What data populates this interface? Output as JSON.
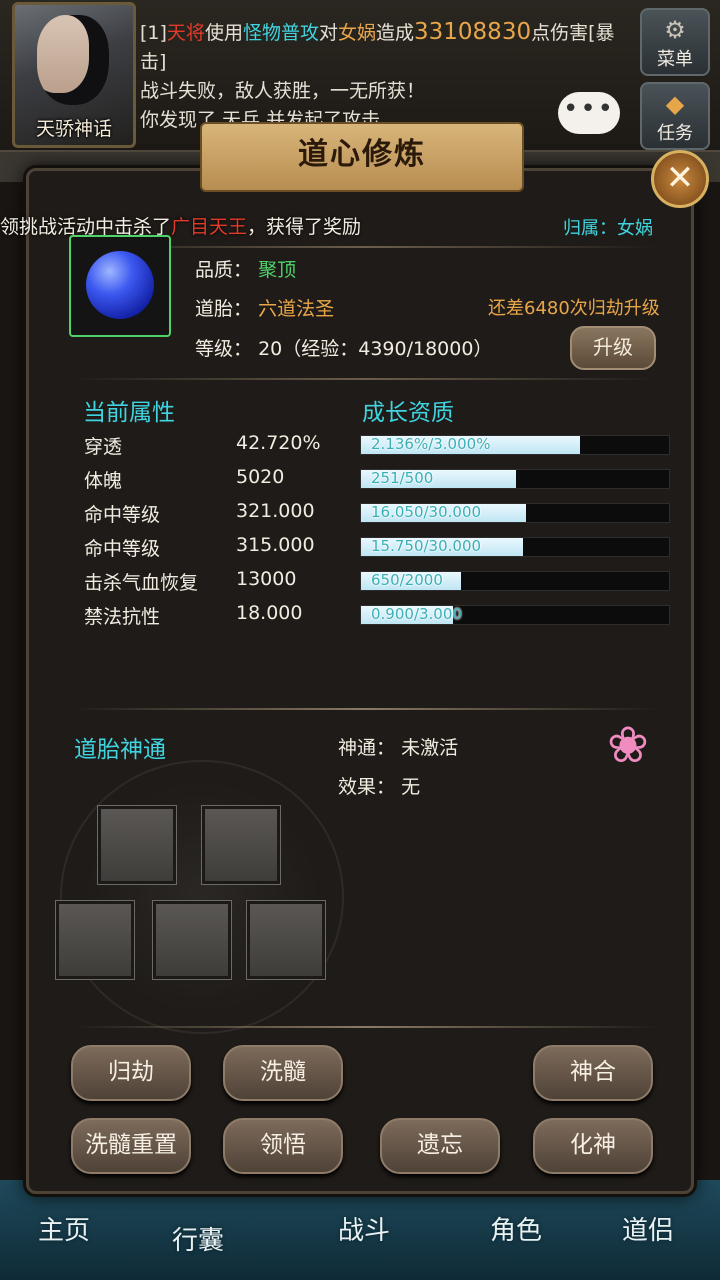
{
  "hud": {
    "player_name": "天骄神话",
    "menu_label": "菜单",
    "quest_label": "任务",
    "chat_bubble": "•••"
  },
  "chat": {
    "line1_prefix": "[1]",
    "line1_attacker": "天将",
    "line1_verb": "使用",
    "line1_skill": "怪物普攻",
    "line1_mid": "对",
    "line1_target": "女娲",
    "line1_mid2": "造成",
    "line1_damage": "33108830",
    "line1_suffix": "点伤害[暴击]",
    "line2": "战斗失败，敌人获胜，一无所获！",
    "line3": "你发现了 天兵 并发起了攻击"
  },
  "system_message": {
    "prefix": "领挑战活动中击杀了",
    "boss": "广目天王",
    "suffix": "，获得了奖励"
  },
  "modal": {
    "title": "道心修炼",
    "close": "✕",
    "belong_label": "归属：",
    "belong_value": "女娲",
    "quality_label": "品质：",
    "quality_value": "聚顶",
    "embryo_label": "道胎：",
    "embryo_value": "六道法圣",
    "need_text": "还差6480次归劫升级",
    "level_label": "等级：",
    "level_value": "20（经验：4390/18000）",
    "upgrade_btn": "升级",
    "section_current": "当前属性",
    "section_growth": "成长资质",
    "section_divine": "道胎神通",
    "divine_label": "神通：",
    "divine_value": "未激活",
    "effect_label": "效果：",
    "effect_value": "无"
  },
  "attributes": [
    {
      "name": "穿透",
      "value": "42.720%",
      "growth": "2.136%/3.000%",
      "fill": 0.712
    },
    {
      "name": "体魄",
      "value": "5020",
      "growth": "251/500",
      "fill": 0.502
    },
    {
      "name": "命中等级",
      "value": "321.000",
      "growth": "16.050/30.000",
      "fill": 0.535
    },
    {
      "name": "命中等级",
      "value": "315.000",
      "growth": "15.750/30.000",
      "fill": 0.525
    },
    {
      "name": "击杀气血恢复",
      "value": "13000",
      "growth": "650/2000",
      "fill": 0.325
    },
    {
      "name": "禁法抗性",
      "value": "18.000",
      "growth": "0.900/3.000",
      "fill": 0.3
    }
  ],
  "actions": {
    "guijie": "归劫",
    "xisui": "洗髓",
    "shenhe": "神合",
    "xisui_reset": "洗髓重置",
    "lingwu": "领悟",
    "yiwang": "遗忘",
    "huashen": "化神"
  },
  "bottom_nav": {
    "home": "主页",
    "bag": "行囊",
    "battle": "战斗",
    "role": "角色",
    "partner": "道侣"
  }
}
